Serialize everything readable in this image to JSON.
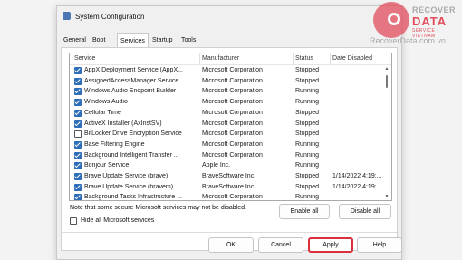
{
  "window": {
    "title": "System Configuration"
  },
  "tabs": [
    "General",
    "Boot",
    "Services",
    "Startup",
    "Tools"
  ],
  "active_tab": "Services",
  "table": {
    "columns": [
      "Service",
      "Manufacturer",
      "Status",
      "Date Disabled"
    ],
    "rows": [
      {
        "checked": true,
        "service": "AppX Deployment Service (AppX...",
        "manufacturer": "Microsoft Corporation",
        "status": "Stopped",
        "date": ""
      },
      {
        "checked": true,
        "service": "AssignedAccessManager Service",
        "manufacturer": "Microsoft Corporation",
        "status": "Stopped",
        "date": ""
      },
      {
        "checked": true,
        "service": "Windows Audio Endpoint Builder",
        "manufacturer": "Microsoft Corporation",
        "status": "Running",
        "date": ""
      },
      {
        "checked": true,
        "service": "Windows Audio",
        "manufacturer": "Microsoft Corporation",
        "status": "Running",
        "date": ""
      },
      {
        "checked": true,
        "service": "Cellular Time",
        "manufacturer": "Microsoft Corporation",
        "status": "Stopped",
        "date": ""
      },
      {
        "checked": true,
        "service": "ActiveX Installer (AxInstSV)",
        "manufacturer": "Microsoft Corporation",
        "status": "Stopped",
        "date": ""
      },
      {
        "checked": false,
        "service": "BitLocker Drive Encryption Service",
        "manufacturer": "Microsoft Corporation",
        "status": "Stopped",
        "date": ""
      },
      {
        "checked": true,
        "service": "Base Filtering Engine",
        "manufacturer": "Microsoft Corporation",
        "status": "Running",
        "date": ""
      },
      {
        "checked": true,
        "service": "Background Intelligent Transfer ...",
        "manufacturer": "Microsoft Corporation",
        "status": "Running",
        "date": ""
      },
      {
        "checked": true,
        "service": "Bonjour Service",
        "manufacturer": "Apple Inc.",
        "status": "Running",
        "date": ""
      },
      {
        "checked": true,
        "service": "Brave Update Service (brave)",
        "manufacturer": "BraveSoftware Inc.",
        "status": "Stopped",
        "date": "1/14/2022 4:19:..."
      },
      {
        "checked": true,
        "service": "Brave Update Service (bravem)",
        "manufacturer": "BraveSoftware Inc.",
        "status": "Stopped",
        "date": "1/14/2022 4:19:..."
      },
      {
        "checked": true,
        "service": "Background Tasks Infrastructure ...",
        "manufacturer": "Microsoft Corporation",
        "status": "Running",
        "date": ""
      }
    ]
  },
  "note": "Note that some secure Microsoft services may not be disabled.",
  "buttons": {
    "enable_all": "Enable all",
    "disable_all": "Disable all",
    "ok": "OK",
    "cancel": "Cancel",
    "apply": "Apply",
    "help": "Help"
  },
  "hide_ms": {
    "label": "Hide all Microsoft services",
    "checked": false
  },
  "watermark": {
    "line1": "RECOVER",
    "line2": "DATA",
    "line3": "SERVICE - VIETNAM",
    "url": "RecoverData.com.vn"
  },
  "colors": {
    "accent": "#2e6db8",
    "apply_border": "#d9303c",
    "brand": "#e24d5c"
  }
}
